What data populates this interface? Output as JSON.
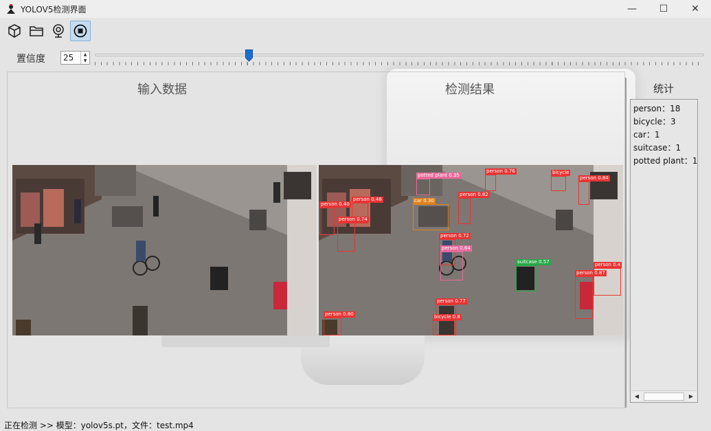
{
  "window": {
    "title": "YOLOV5检测界面",
    "controls": {
      "minimize": "—",
      "maximize": "☐",
      "close": "✕"
    }
  },
  "toolbar": {
    "buttons": [
      {
        "icon": "model-cube-icon",
        "active": false
      },
      {
        "icon": "folder-open-icon",
        "active": false
      },
      {
        "icon": "webcam-icon",
        "active": false
      },
      {
        "icon": "stop-icon",
        "active": true
      }
    ]
  },
  "confidence": {
    "label": "置信度",
    "value": "25",
    "slider_percent": 25,
    "accent": "#1c6fd1"
  },
  "panels": {
    "input_title": "输入数据",
    "result_title": "检测结果"
  },
  "detections": [
    {
      "label": "person 0.40",
      "kind": "person"
    },
    {
      "label": "person 0.74",
      "kind": "person"
    },
    {
      "label": "person 0.48",
      "kind": "person"
    },
    {
      "label": "person 0.76",
      "kind": "person"
    },
    {
      "label": "person 0.84",
      "kind": "person"
    },
    {
      "label": "person 0.82",
      "kind": "person"
    },
    {
      "label": "person 0.72",
      "kind": "person"
    },
    {
      "label": "person 0.64",
      "kind": "person"
    },
    {
      "label": "person 0.87",
      "kind": "person"
    },
    {
      "label": "person 0.80",
      "kind": "person"
    },
    {
      "label": "person 0.77",
      "kind": "person"
    },
    {
      "label": "person 0.4",
      "kind": "person"
    },
    {
      "label": "potted plant 0.35",
      "kind": "plant"
    },
    {
      "label": "car 0.30",
      "kind": "car"
    },
    {
      "label": "bicycle",
      "kind": "bicycle"
    },
    {
      "label": "suitcase 0.57",
      "kind": "suitcase"
    },
    {
      "label": "bicycle 0.8",
      "kind": "bicycle"
    }
  ],
  "stats": {
    "title": "统计",
    "items": [
      {
        "text": "person：18"
      },
      {
        "text": "bicycle：3"
      },
      {
        "text": "car：1"
      },
      {
        "text": "suitcase：1"
      },
      {
        "text": "potted plant：1"
      }
    ]
  },
  "statusbar": {
    "text": "正在检测 >> 模型：yolov5s.pt，文件：test.mp4"
  }
}
